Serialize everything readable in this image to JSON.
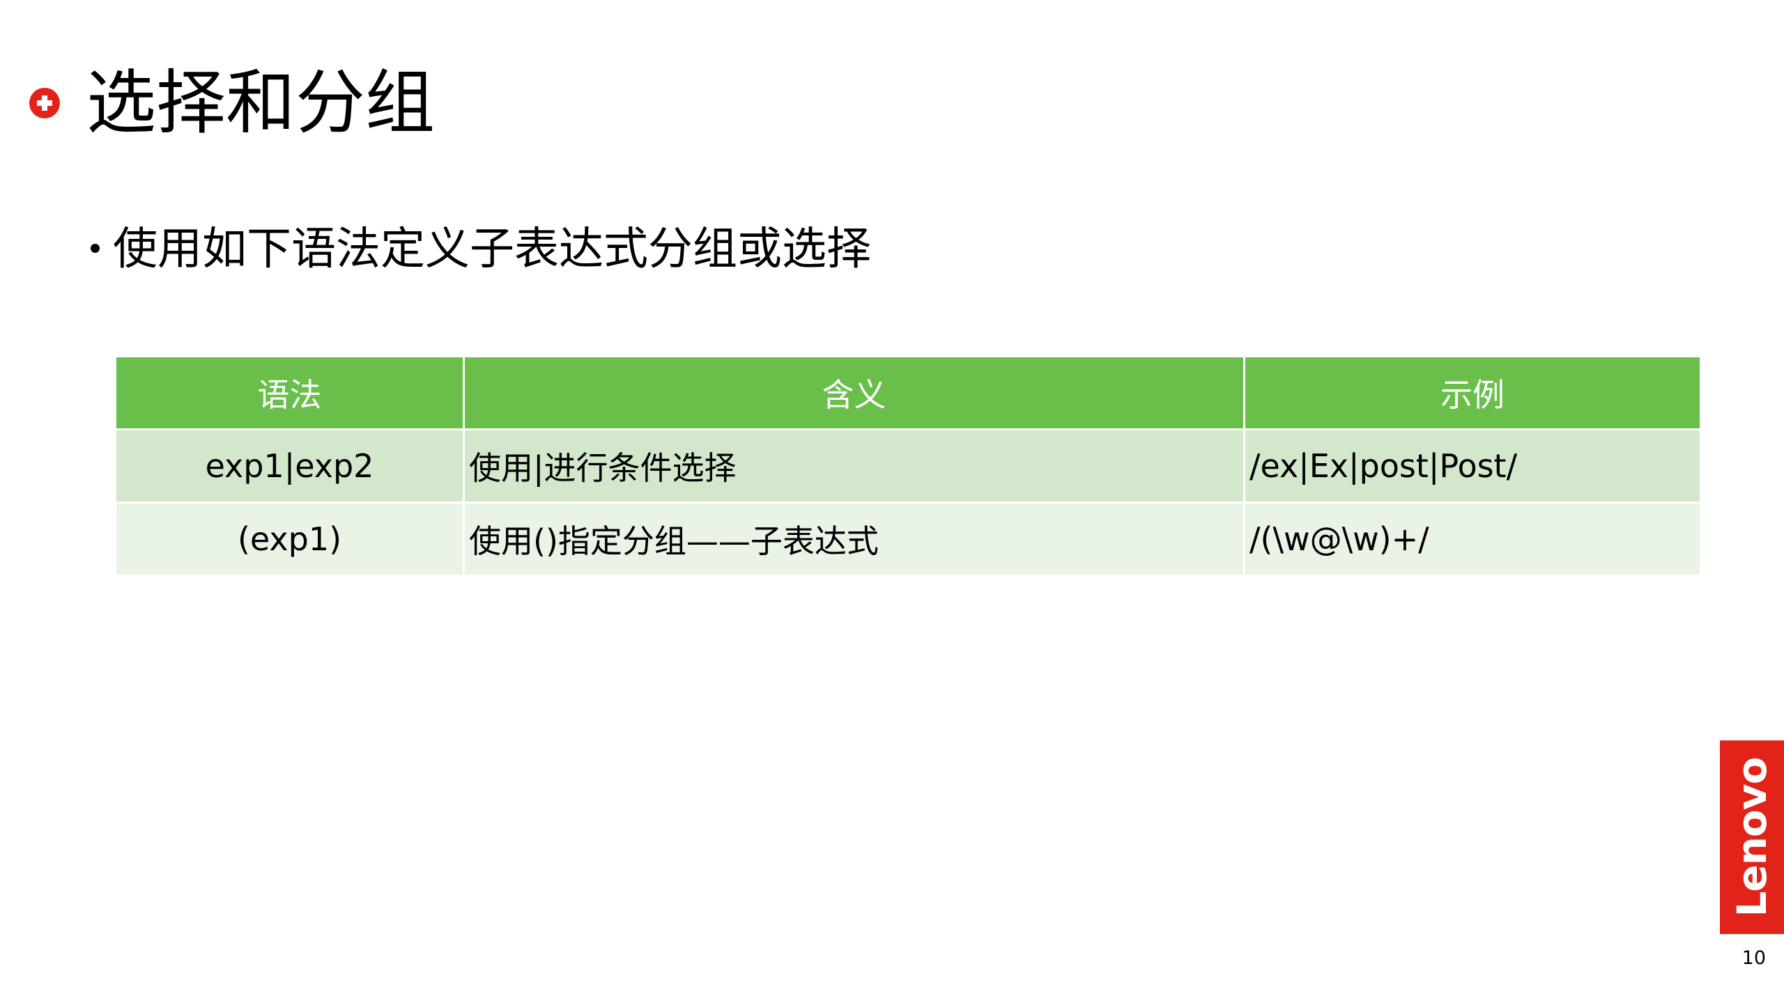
{
  "slide": {
    "title": "选择和分组",
    "bullet": "使用如下语法定义子表达式分组或选择",
    "table": {
      "headers": [
        "语法",
        "含义",
        "示例"
      ],
      "rows": [
        [
          "exp1|exp2",
          "使用|进行条件选择",
          "/ex|Ex|post|Post/"
        ],
        [
          "(exp1)",
          "使用()指定分组——子表达式",
          "/(\\w@\\w)+/"
        ]
      ]
    },
    "logo_text": "Lenovo",
    "page_number": "10"
  },
  "colors": {
    "header_bg": "#6abf4b",
    "row_odd_bg": "#d3e7cc",
    "row_even_bg": "#e9f3e6",
    "brand_red": "#e2231a"
  }
}
